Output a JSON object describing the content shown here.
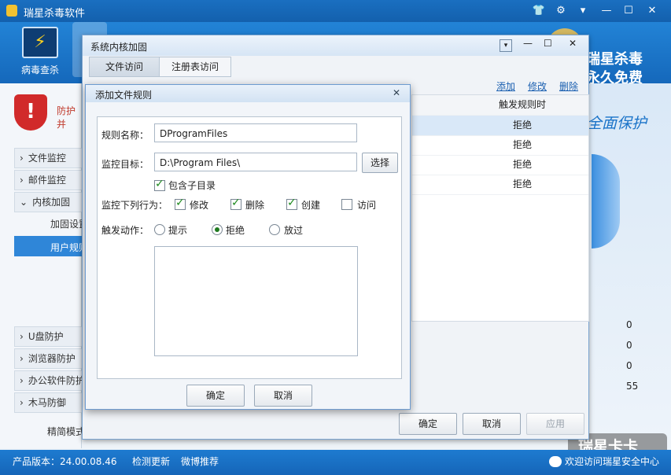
{
  "app": {
    "title": "瑞星杀毒软件",
    "brand_line1": "瑞星杀毒",
    "brand_line2": "永久免费",
    "topbar_item": "病毒查杀",
    "promo": "全面保护",
    "watermark": "瑞星卡卡",
    "watermark_sub": "欢迎访问瑞星安全中心"
  },
  "sidebar": {
    "protect_text": "防护并",
    "items": [
      "文件监控",
      "邮件监控",
      "内核加固"
    ],
    "subitems": [
      "加固设置",
      "用户规则"
    ],
    "items_bottom": [
      "U盘防护",
      "浏览器防护",
      "办公软件防护",
      "木马防御"
    ],
    "simple_mode": "精简模式"
  },
  "right_numbers": [
    "0",
    "0",
    "0",
    "55"
  ],
  "statusbar": {
    "version": "产品版本：24.00.08.46",
    "update": "检测更新",
    "weibo": "微博推荐"
  },
  "outer_dialog": {
    "title": "系统内核加固",
    "tabs": [
      "文件访问",
      "注册表访问"
    ],
    "links": [
      "添加",
      "修改",
      "删除"
    ],
    "column_header": "触发规则时",
    "rows": [
      "拒绝",
      "拒绝",
      "拒绝",
      "拒绝"
    ],
    "ok": "确定",
    "cancel": "取消",
    "apply": "应用"
  },
  "inner_dialog": {
    "title": "添加文件规则",
    "rule_name_label": "规则名称：",
    "rule_name_value": "DProgramFiles",
    "target_label": "监控目标：",
    "target_value": "D:\\Program Files\\",
    "browse": "选择",
    "include_sub": "包含子目录",
    "behaviors_label": "监控下列行为：",
    "behaviors": [
      {
        "label": "修改",
        "checked": true
      },
      {
        "label": "删除",
        "checked": true
      },
      {
        "label": "创建",
        "checked": true
      },
      {
        "label": "访问",
        "checked": false
      }
    ],
    "action_label": "触发动作：",
    "actions": [
      {
        "label": "提示",
        "selected": false
      },
      {
        "label": "拒绝",
        "selected": true
      },
      {
        "label": "放过",
        "selected": false
      }
    ],
    "ok": "确定",
    "cancel": "取消"
  },
  "colors": {
    "titlebar": "#1a6fc0",
    "accent": "#1f7a1f",
    "dialog_border": "#6d9bd0"
  }
}
